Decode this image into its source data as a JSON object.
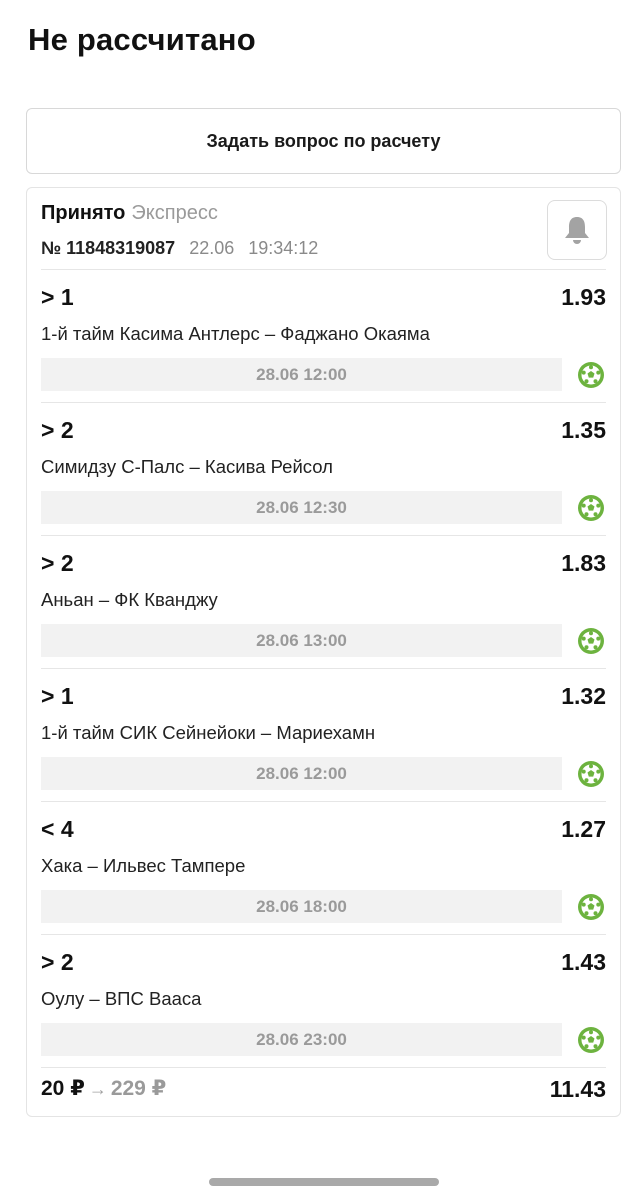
{
  "page_title": "Не рассчитано",
  "ask_button_label": "Задать вопрос по расчету",
  "bet": {
    "status": "Принято",
    "type": "Экспресс",
    "number": "№ 11848319087",
    "date": "22.06",
    "time": "19:34:12",
    "bell_icon": "bell-icon",
    "selections": [
      {
        "outcome": "> 1",
        "odds": "1.93",
        "event": "1-й тайм Касима Антлерс – Фаджано Окаяма",
        "start": "28.06 12:00",
        "sport_icon": "soccer-ball-icon"
      },
      {
        "outcome": "> 2",
        "odds": "1.35",
        "event": "Симидзу С-Палс – Касива Рейсол",
        "start": "28.06 12:30",
        "sport_icon": "soccer-ball-icon"
      },
      {
        "outcome": "> 2",
        "odds": "1.83",
        "event": "Аньан – ФК Кванджу",
        "start": "28.06 13:00",
        "sport_icon": "soccer-ball-icon"
      },
      {
        "outcome": "> 1",
        "odds": "1.32",
        "event": "1-й тайм СИК Сейнейоки – Мариехамн",
        "start": "28.06 12:00",
        "sport_icon": "soccer-ball-icon"
      },
      {
        "outcome": "< 4",
        "odds": "1.27",
        "event": "Хака – Ильвес Тампере",
        "start": "28.06 18:00",
        "sport_icon": "soccer-ball-icon"
      },
      {
        "outcome": "> 2",
        "odds": "1.43",
        "event": "Оулу – ВПС Вааса",
        "start": "28.06 23:00",
        "sport_icon": "soccer-ball-icon"
      }
    ],
    "stake": "20 ₽",
    "arrow": "→",
    "payout": "229 ₽",
    "total_odds": "11.43"
  },
  "colors": {
    "sport_icon": "#6db33f",
    "muted_text": "#9a9a9a",
    "date_bar_bg": "#f2f2f2"
  }
}
